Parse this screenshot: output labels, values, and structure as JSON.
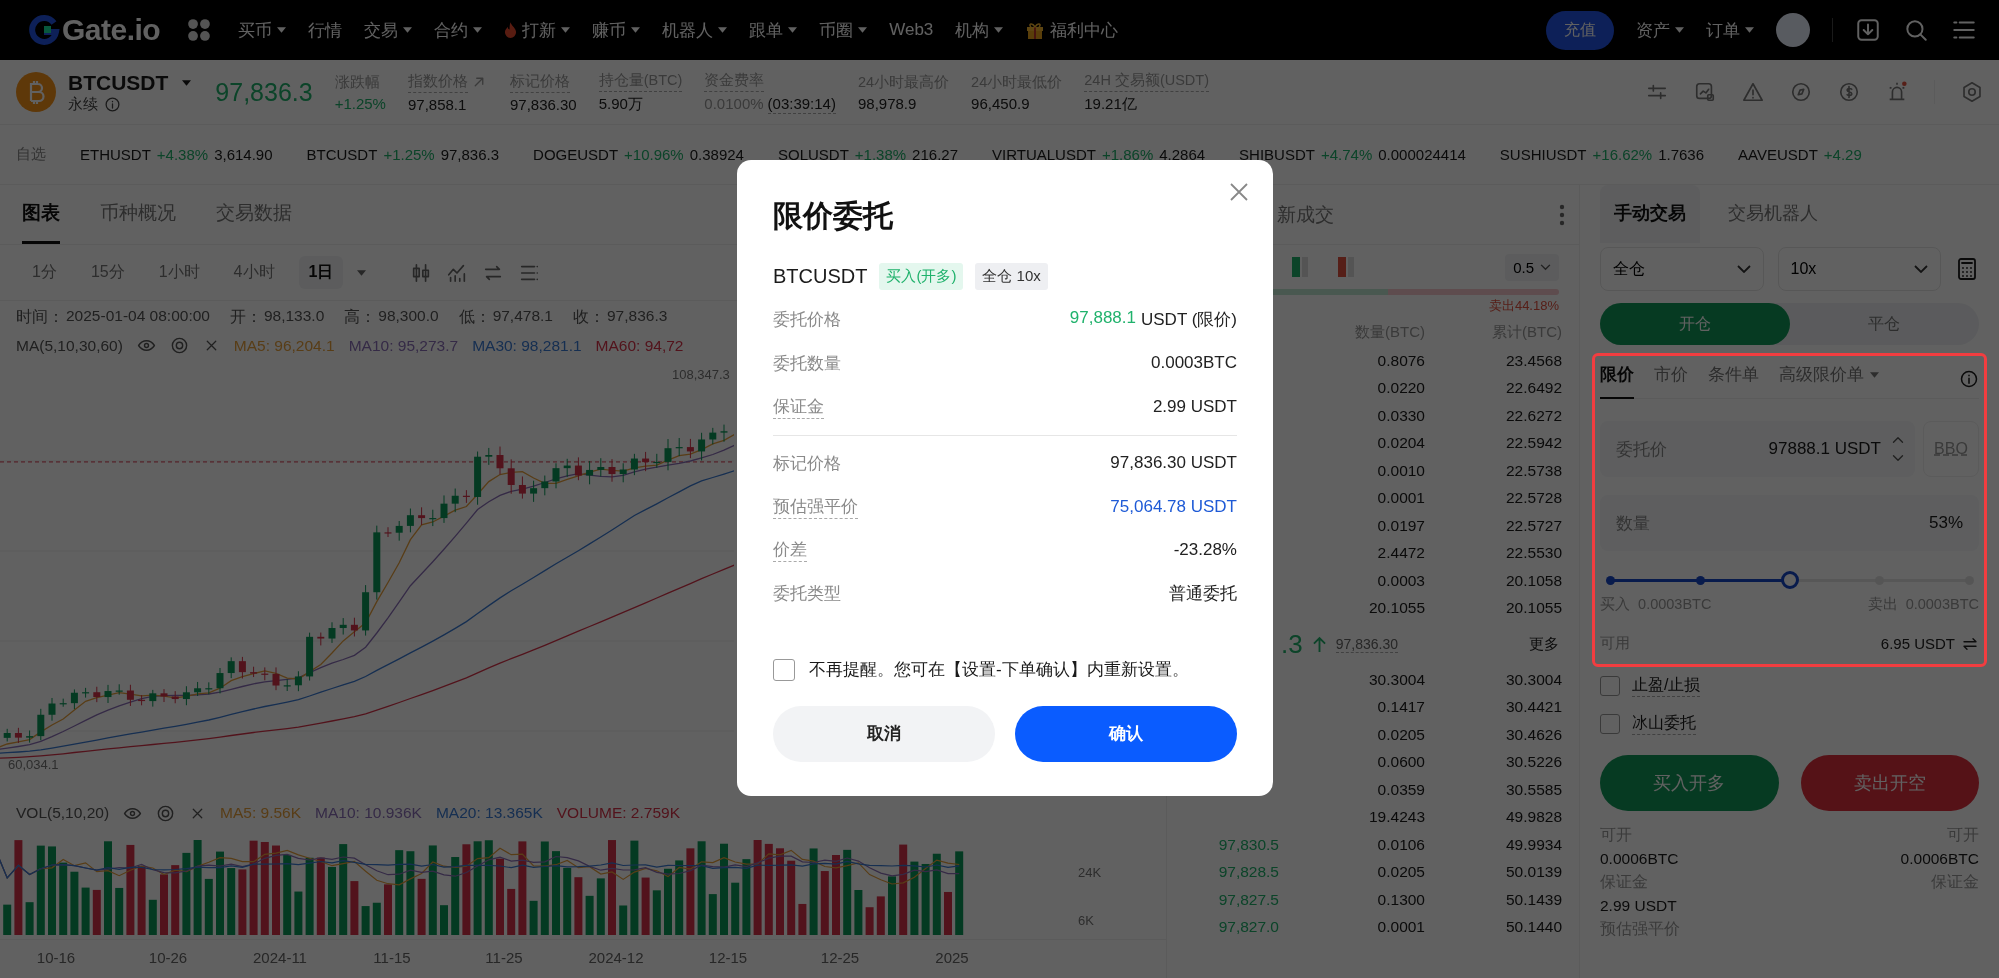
{
  "nav": {
    "logo": "Gate.io",
    "items": [
      {
        "label": "买币",
        "dropdown": true,
        "kind": "plain"
      },
      {
        "label": "行情",
        "dropdown": false,
        "kind": "plain"
      },
      {
        "label": "交易",
        "dropdown": true,
        "kind": "plain"
      },
      {
        "label": "合约",
        "dropdown": true,
        "kind": "plain"
      },
      {
        "label": "打新",
        "dropdown": true,
        "kind": "hot"
      },
      {
        "label": "赚币",
        "dropdown": true,
        "kind": "plain"
      },
      {
        "label": "机器人",
        "dropdown": true,
        "kind": "plain"
      },
      {
        "label": "跟单",
        "dropdown": true,
        "kind": "plain"
      },
      {
        "label": "币圈",
        "dropdown": true,
        "kind": "plain"
      },
      {
        "label": "Web3",
        "dropdown": false,
        "kind": "plain"
      },
      {
        "label": "机构",
        "dropdown": true,
        "kind": "plain"
      },
      {
        "label": "福利中心",
        "dropdown": false,
        "kind": "gift"
      }
    ],
    "deposit": "充值",
    "menus": [
      {
        "label": "资产"
      },
      {
        "label": "订单"
      }
    ]
  },
  "ticker": {
    "symbol": "BTCUSDT",
    "contract": "永续",
    "last_price": "97,836.3",
    "stats": [
      {
        "label": "涨跌幅",
        "value": "+1.25%",
        "kind": "change",
        "underlined": false
      },
      {
        "label": "指数价格",
        "value": "97,858.1",
        "kind": "index",
        "underlined": true
      },
      {
        "label": "标记价格",
        "value": "97,836.30",
        "kind": "price",
        "underlined": true
      },
      {
        "label": "持仓量(BTC)",
        "value": "5.90万",
        "kind": "price",
        "underlined": true
      },
      {
        "label": "资金费率",
        "value": "0.0100%",
        "extra": "(03:39:14)",
        "kind": "funding",
        "underlined": true
      },
      {
        "label": "24小时最高价",
        "value": "98,978.9",
        "kind": "price",
        "underlined": false
      },
      {
        "label": "24小时最低价",
        "value": "96,450.9",
        "kind": "price",
        "underlined": false
      },
      {
        "label": "24H 交易额(USDT)",
        "value": "19.21亿",
        "kind": "price",
        "underlined": true
      }
    ]
  },
  "favorites": {
    "label": "自选",
    "items": [
      {
        "symbol": "ETHUSDT",
        "change": "+4.38%",
        "price": "3,614.90"
      },
      {
        "symbol": "BTCUSDT",
        "change": "+1.25%",
        "price": "97,836.3"
      },
      {
        "symbol": "DOGEUSDT",
        "change": "+10.96%",
        "price": "0.38924"
      },
      {
        "symbol": "SOLUSDT",
        "change": "+1.38%",
        "price": "216.27"
      },
      {
        "symbol": "VIRTUALUSDT",
        "change": "+1.86%",
        "price": "4.2864"
      },
      {
        "symbol": "SHIBUSDT",
        "change": "+4.74%",
        "price": "0.000024414"
      },
      {
        "symbol": "SUSHIUSDT",
        "change": "+16.62%",
        "price": "1.7636"
      },
      {
        "symbol": "AAVEUSDT",
        "change": "+4.29"
      }
    ]
  },
  "chart_panel": {
    "tabs": [
      {
        "label": "图表",
        "selected": true
      },
      {
        "label": "币种概况",
        "selected": false
      },
      {
        "label": "交易数据",
        "selected": false
      }
    ],
    "intervals": [
      {
        "label": "1分",
        "selected": false
      },
      {
        "label": "15分",
        "selected": false
      },
      {
        "label": "1小时",
        "selected": false
      },
      {
        "label": "4小时",
        "selected": false
      },
      {
        "label": "1日",
        "selected": true
      }
    ],
    "ohlc": [
      {
        "label": "时间：",
        "value": "2025-01-04 08:00:00"
      },
      {
        "label": "开：",
        "value": "98,133.0"
      },
      {
        "label": "高：",
        "value": "98,300.0"
      },
      {
        "label": "低：",
        "value": "97,478.1"
      },
      {
        "label": "收：",
        "value": "97,836.3"
      }
    ],
    "ma_name": "MA(5,10,30,60)",
    "ma_values": [
      "MA5: 96,204.1",
      "MA10: 95,273.7",
      "MA30: 98,281.1",
      "MA60: 94,72"
    ],
    "high_marker": "108,347.3",
    "low_marker": "60,034.1",
    "vol_name": "VOL(5,10,20)",
    "vol_values": [
      "MA5: 9.56K",
      "MA10: 10.936K",
      "MA20: 13.365K",
      "VOLUME: 2.759K"
    ],
    "vol_axis": [
      "24K",
      "6K"
    ],
    "x_labels": [
      "10-16",
      "10-26",
      "2024-11",
      "11-15",
      "11-25",
      "2024-12",
      "12-15",
      "12-25",
      "2025"
    ]
  },
  "order_book": {
    "title": "新成交",
    "step": "0.5",
    "sell_ratio": "卖出44.18%",
    "ratio_bar": {
      "level": 0.5582
    },
    "columns": [
      "数量(BTC)",
      "累计(BTC)"
    ],
    "asks": [
      {
        "amount": "0.8076",
        "total": "23.4568"
      },
      {
        "amount": "0.0220",
        "total": "22.6492"
      },
      {
        "amount": "0.0330",
        "total": "22.6272"
      },
      {
        "amount": "0.0204",
        "total": "22.5942"
      },
      {
        "amount": "0.0010",
        "total": "22.5738"
      },
      {
        "amount": "0.0001",
        "total": "22.5728"
      },
      {
        "amount": "0.0197",
        "total": "22.5727"
      },
      {
        "amount": "2.4472",
        "total": "22.5530"
      },
      {
        "amount": "0.0003",
        "total": "20.1058"
      },
      {
        "amount": "20.1055",
        "total": "20.1055"
      }
    ],
    "last_price": ".3",
    "mark_price": "97,836.30",
    "more": "更多",
    "bids": [
      {
        "amount": "30.3004",
        "total": "30.3004"
      },
      {
        "amount": "0.1417",
        "total": "30.4421"
      },
      {
        "amount": "0.0205",
        "total": "30.4626"
      },
      {
        "amount": "0.0600",
        "total": "30.5226"
      },
      {
        "amount": "0.0359",
        "total": "30.5585"
      },
      {
        "amount": "19.4243",
        "total": "49.9828"
      },
      {
        "price": "97,830.5",
        "amount": "0.0106",
        "total": "49.9934"
      },
      {
        "price": "97,828.5",
        "amount": "0.0205",
        "total": "50.0139"
      },
      {
        "price": "97,827.5",
        "amount": "0.1300",
        "total": "50.1439"
      },
      {
        "price": "97,827.0",
        "amount": "0.0001",
        "total": "50.1440"
      }
    ]
  },
  "trade_panel": {
    "tabs": [
      {
        "label": "手动交易",
        "selected": true
      },
      {
        "label": "交易机器人",
        "selected": false
      }
    ],
    "margin_mode": "全仓",
    "leverage": "10x",
    "sides": [
      {
        "label": "开仓",
        "selected": true
      },
      {
        "label": "平仓",
        "selected": false
      }
    ],
    "order_types": [
      {
        "label": "限价",
        "selected": true,
        "dropdown": false
      },
      {
        "label": "市价",
        "selected": false,
        "dropdown": false
      },
      {
        "label": "条件单",
        "selected": false,
        "dropdown": false
      },
      {
        "label": "高级限价单",
        "selected": false,
        "dropdown": true
      }
    ],
    "price_field": {
      "label": "委托价",
      "value": "97888.1 USDT"
    },
    "bbo": "BBO",
    "amount_field": {
      "label": "数量",
      "value": "53%"
    },
    "slider": {
      "level": 0.5
    },
    "buy_max": {
      "label": "买入",
      "value": "0.0003BTC"
    },
    "sell_max": {
      "label": "卖出",
      "value": "0.0003BTC"
    },
    "available": {
      "label": "可用",
      "value": "6.95 USDT"
    },
    "options": [
      {
        "label": "止盈/止损",
        "checked": false
      },
      {
        "label": "冰山委托",
        "checked": false
      }
    ],
    "buy_button": "买入开多",
    "sell_button": "卖出开空",
    "summary": [
      {
        "left": {
          "label": "可开",
          "value": "0.0006BTC"
        },
        "right": {
          "label": "可开",
          "value": "0.0006BTC"
        }
      },
      {
        "left": {
          "label": "保证金",
          "value": "2.99 USDT"
        },
        "right": {
          "label": "保证金"
        }
      },
      {
        "left": {
          "label": "预估强平价"
        }
      }
    ]
  },
  "modal": {
    "title": "限价委托",
    "symbol": "BTCUSDT",
    "tags": [
      {
        "label": "买入(开多)",
        "kind": "buy"
      },
      {
        "label": "全仓 10x",
        "kind": "mode"
      }
    ],
    "rows": [
      {
        "label": "委托价格",
        "accent": "97,888.1",
        "value": "USDT (限价)",
        "highlighted": false,
        "underlined": false
      },
      {
        "label": "委托数量",
        "value": "0.0003BTC",
        "highlighted": false,
        "underlined": false
      },
      {
        "label": "保证金",
        "value": "2.99 USDT",
        "highlighted": false,
        "underlined": true
      },
      {
        "label": "标记价格",
        "value": "97,836.30 USDT",
        "highlighted": false,
        "underlined": false
      },
      {
        "label": "预估强平价",
        "value": "75,064.78 USDT",
        "highlighted": true,
        "underlined": true
      },
      {
        "label": "价差",
        "value": "-23.28%",
        "highlighted": false,
        "underlined": true
      },
      {
        "label": "委托类型",
        "value": "普通委托",
        "highlighted": false,
        "underlined": false
      }
    ],
    "dont_remind": {
      "label": "不再提醒。您可在【设置-下单确认】内重新设置。",
      "checked": false
    },
    "buttons": [
      {
        "label": "取消",
        "kind": "secondary"
      },
      {
        "label": "确认",
        "kind": "primary"
      }
    ]
  }
}
